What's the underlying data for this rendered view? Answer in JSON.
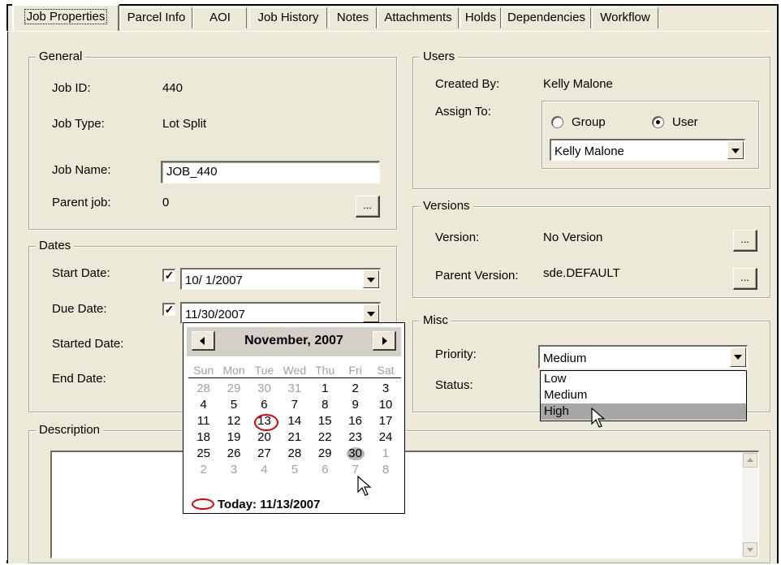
{
  "tabs": [
    {
      "label": "Job Properties",
      "active": true
    },
    {
      "label": "Parcel Info"
    },
    {
      "label": "AOI"
    },
    {
      "label": "Job History"
    },
    {
      "label": "Notes"
    },
    {
      "label": "Attachments"
    },
    {
      "label": "Holds"
    },
    {
      "label": "Dependencies"
    },
    {
      "label": "Workflow"
    }
  ],
  "general": {
    "title": "General",
    "job_id_label": "Job ID:",
    "job_id": "440",
    "job_type_label": "Job Type:",
    "job_type": "Lot Split",
    "job_name_label": "Job Name:",
    "job_name": "JOB_440",
    "parent_job_label": "Parent job:",
    "parent_job": "0",
    "browse_label": "..."
  },
  "dates": {
    "title": "Dates",
    "start_label": "Start Date:",
    "start_checked": true,
    "start_value": "10/ 1/2007",
    "due_label": "Due Date:",
    "due_checked": true,
    "due_value": "11/30/2007",
    "started_label": "Started Date:",
    "end_label": "End Date:"
  },
  "users": {
    "title": "Users",
    "created_by_label": "Created By:",
    "created_by": "Kelly Malone",
    "assign_to_label": "Assign To:",
    "group_label": "Group",
    "user_label": "User",
    "selected": "User",
    "assignee": "Kelly Malone"
  },
  "versions": {
    "title": "Versions",
    "version_label": "Version:",
    "version": "No Version",
    "parent_version_label": "Parent Version:",
    "parent_version": "sde.DEFAULT",
    "browse_label": "..."
  },
  "misc": {
    "title": "Misc",
    "priority_label": "Priority:",
    "priority": "Medium",
    "status_label": "Status:",
    "priority_options": [
      "Low",
      "Medium",
      "High"
    ],
    "highlighted_option": "High"
  },
  "description": {
    "title": "Description",
    "text": ""
  },
  "calendar": {
    "month_title": "November, 2007",
    "weekdays": [
      "Sun",
      "Mon",
      "Tue",
      "Wed",
      "Thu",
      "Fri",
      "Sat"
    ],
    "weeks": [
      [
        "28",
        "29",
        "30",
        "31",
        "1",
        "2",
        "3"
      ],
      [
        "4",
        "5",
        "6",
        "7",
        "8",
        "9",
        "10"
      ],
      [
        "11",
        "12",
        "13",
        "14",
        "15",
        "16",
        "17"
      ],
      [
        "18",
        "19",
        "20",
        "21",
        "22",
        "23",
        "24"
      ],
      [
        "25",
        "26",
        "27",
        "28",
        "29",
        "30",
        "1"
      ],
      [
        "2",
        "3",
        "4",
        "5",
        "6",
        "7",
        "8"
      ]
    ],
    "today_day": "13",
    "selected_day": "30",
    "today_text": "Today: 11/13/2007"
  },
  "colors": {
    "panel": "#ece9d8",
    "today_circle": "#e00000",
    "highlight": "#a6a6a6"
  }
}
